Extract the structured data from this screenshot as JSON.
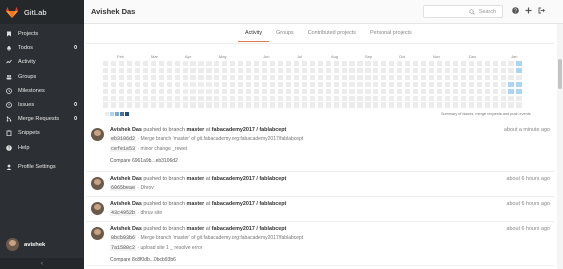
{
  "app": {
    "name": "GitLab"
  },
  "sidebar": {
    "items": [
      {
        "label": "Projects",
        "icon": "bookmark-icon",
        "count": ""
      },
      {
        "label": "Todos",
        "icon": "bell-icon",
        "count": "0"
      },
      {
        "label": "Activity",
        "icon": "dashboard-icon",
        "count": ""
      },
      {
        "label": "Groups",
        "icon": "group-icon",
        "count": ""
      },
      {
        "label": "Milestones",
        "icon": "clock-icon",
        "count": ""
      },
      {
        "label": "Issues",
        "icon": "exclamation-icon",
        "count": "0"
      },
      {
        "label": "Merge Requests",
        "icon": "merge-icon",
        "count": "0"
      },
      {
        "label": "Snippets",
        "icon": "clipboard-icon",
        "count": ""
      },
      {
        "label": "Help",
        "icon": "question-icon",
        "count": ""
      }
    ],
    "profile_settings": "Profile Settings",
    "username": "avishek",
    "collapse_glyph": "‹"
  },
  "header": {
    "title": "Avishek Das"
  },
  "search": {
    "placeholder": "Search"
  },
  "tabs": [
    {
      "label": "Activity",
      "active": true
    },
    {
      "label": "Groups",
      "active": false
    },
    {
      "label": "Contributed projects",
      "active": false
    },
    {
      "label": "Personal projects",
      "active": false
    }
  ],
  "calendar": {
    "months": [
      "Feb",
      "Mar",
      "Apr",
      "May",
      "Jun",
      "Jul",
      "Aug",
      "Sep",
      "Oct",
      "Nov",
      "Dec",
      "Jan"
    ],
    "summary": "Summary of issues, merge requests and push events",
    "colors": {
      "empty": "#ececec",
      "l1": "#acd5f2",
      "l2": "#7fa8d1",
      "l3": "#49729b",
      "l4": "#254e77"
    }
  },
  "events": [
    {
      "author": "Avishek Das",
      "action": "pushed to branch",
      "branch": "master",
      "at": "at",
      "project": "fabacademy2017 / fablabcept",
      "time": "about a minute ago",
      "commits": [
        {
          "sha": "eb3106d2",
          "message": "Merge branch 'master' of git.fabacademy.org:fabacademy2017/fablabcept"
        },
        {
          "sha": "cefe1e53",
          "message": "minor change _rewet"
        }
      ],
      "compare": "Compare 6961a9b...eb3106d2"
    },
    {
      "author": "Avishek Das",
      "action": "pushed to branch",
      "branch": "master",
      "at": "at",
      "project": "fabacademy2017 / fablabcept",
      "time": "about 6 hours ago",
      "commits": [
        {
          "sha": "6065beae",
          "message": "Dhrov"
        }
      ]
    },
    {
      "author": "Avishek Das",
      "action": "pushed to branch",
      "branch": "master",
      "at": "at",
      "project": "fabacademy2017 / fablabcept",
      "time": "about 6 hours ago",
      "commits": [
        {
          "sha": "43c4952b",
          "message": "dhruv site"
        }
      ]
    },
    {
      "author": "Avishek Das",
      "action": "pushed to branch",
      "branch": "master",
      "at": "at",
      "project": "fabacademy2017 / fablabcept",
      "time": "about 6 hours ago",
      "commits": [
        {
          "sha": "0bcb93b6",
          "message": "Merge branch 'master' of git.fabacademy.org:fabacademy2017/fablabcept"
        },
        {
          "sha": "7a1580c2",
          "message": "upload site 1 _ resolve error"
        }
      ],
      "compare": "Compare 8c8f0db...0bcb93b6"
    }
  ]
}
